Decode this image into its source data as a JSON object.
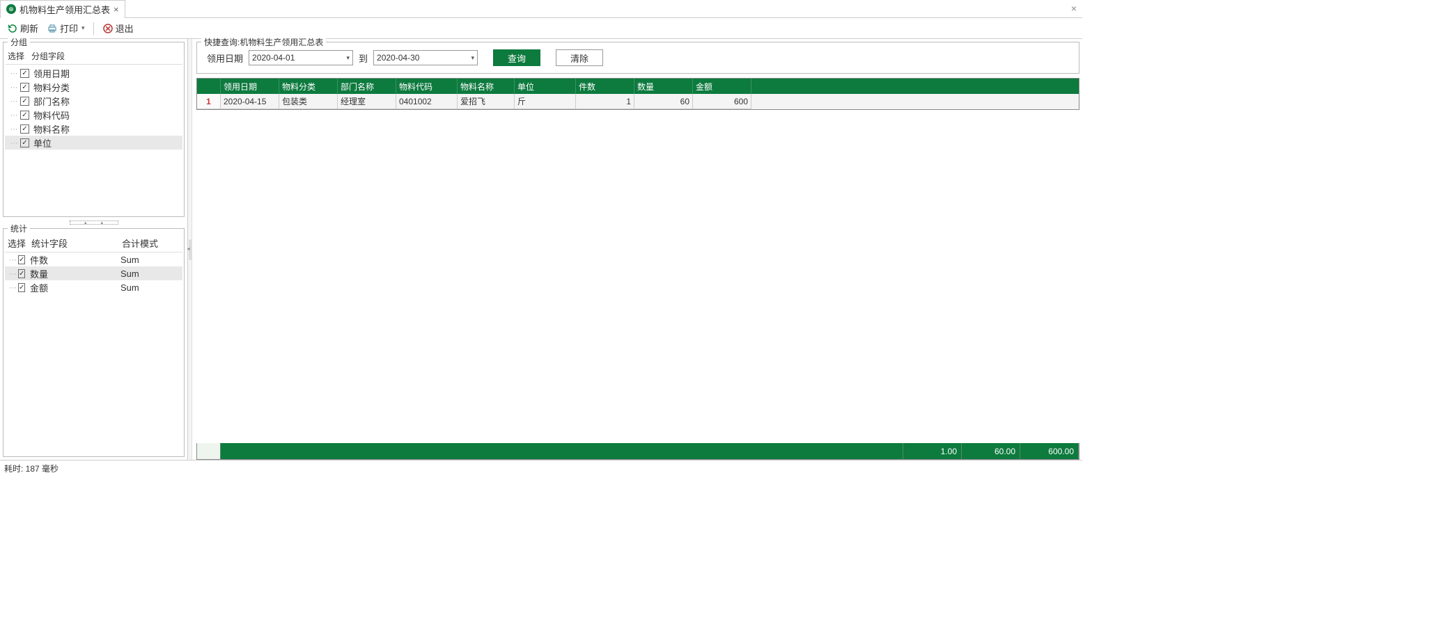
{
  "tab": {
    "title": "机物料生产领用汇总表"
  },
  "toolbar": {
    "refresh": "刷新",
    "print": "打印",
    "exit": "退出"
  },
  "left": {
    "group_title": "分组",
    "col_select": "选择",
    "col_field": "分组字段",
    "items": [
      {
        "label": "领用日期",
        "checked": true
      },
      {
        "label": "物料分类",
        "checked": true
      },
      {
        "label": "部门名称",
        "checked": true
      },
      {
        "label": "物料代码",
        "checked": true
      },
      {
        "label": "物料名称",
        "checked": true
      },
      {
        "label": "单位",
        "checked": true,
        "selected": true
      }
    ],
    "stat_title": "统计",
    "stat_cols": {
      "select": "选择",
      "field": "统计字段",
      "mode": "合计模式"
    },
    "stat_items": [
      {
        "label": "件数",
        "mode": "Sum",
        "checked": true
      },
      {
        "label": "数量",
        "mode": "Sum",
        "checked": true,
        "selected": true
      },
      {
        "label": "金额",
        "mode": "Sum",
        "checked": true
      }
    ]
  },
  "filter": {
    "title": "快捷查询:机物料生产领用汇总表",
    "date_label": "领用日期",
    "date_from": "2020-04-01",
    "to": "到",
    "date_to": "2020-04-30",
    "query": "查询",
    "clear": "清除"
  },
  "table": {
    "headers": [
      "领用日期",
      "物料分类",
      "部门名称",
      "物料代码",
      "物料名称",
      "单位",
      "件数",
      "数量",
      "金额"
    ],
    "rows": [
      {
        "n": "1",
        "cells": [
          "2020-04-15",
          "包装类",
          "经理室",
          "0401002",
          "爱招飞",
          "斤",
          "1",
          "60",
          "600"
        ]
      }
    ],
    "footer": [
      "1.00",
      "60.00",
      "600.00"
    ]
  },
  "status": "耗时: 187 毫秒"
}
